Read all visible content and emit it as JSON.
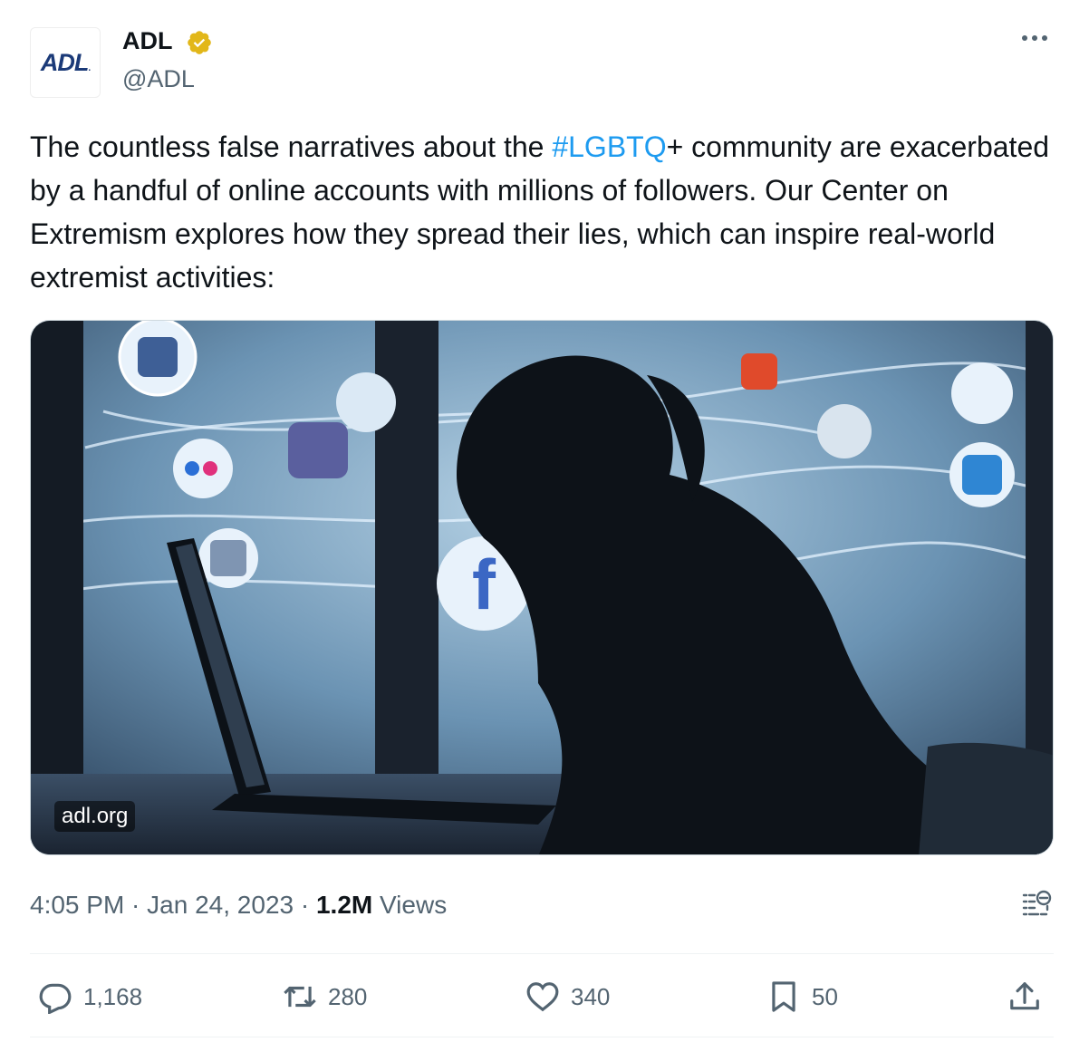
{
  "author": {
    "avatar_text": "ADL",
    "display_name": "ADL",
    "handle": "@ADL",
    "verified": true
  },
  "tweet": {
    "text_before": "The countless false narratives about the ",
    "hashtag": "#LGBTQ",
    "text_after": "+ community are exacerbated by a handful of online accounts with millions of followers. Our Center on Extremism explores how they spread their lies, which can inspire real-world extremist activities:"
  },
  "media": {
    "domain": "adl.org"
  },
  "meta": {
    "time": "4:05 PM",
    "sep1": " · ",
    "date": "Jan 24, 2023",
    "sep2": " · ",
    "views_count": "1.2M",
    "views_label": " Views"
  },
  "actions": {
    "reply_count": "1,168",
    "retweet_count": "280",
    "like_count": "340",
    "bookmark_count": "50"
  },
  "colors": {
    "accent": "#1d9bf0",
    "verified_gold": "#e2b719",
    "secondary_text": "#536471"
  },
  "icons": [
    "verified-badge-icon",
    "more-icon",
    "analytics-icon",
    "reply-icon",
    "retweet-icon",
    "like-icon",
    "bookmark-icon",
    "share-icon"
  ]
}
